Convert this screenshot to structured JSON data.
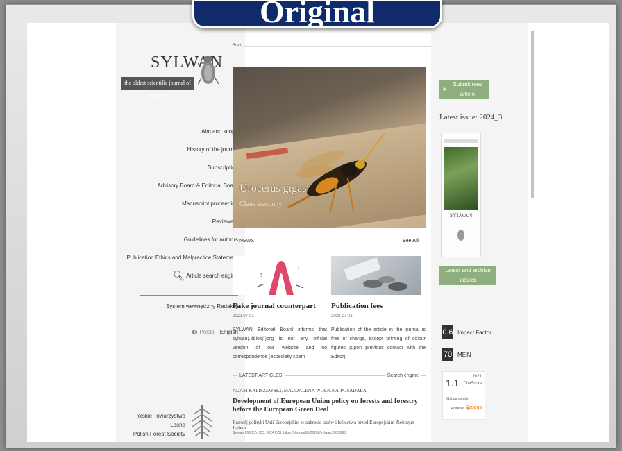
{
  "banner": {
    "label": "Original"
  },
  "journal": {
    "name": "SYLWAN",
    "tagline": "the oldest scientific journal of forestry"
  },
  "sidebar": {
    "menu": [
      {
        "label": "Aim and scope"
      },
      {
        "label": "History of the journal"
      },
      {
        "label": "Subscription"
      },
      {
        "label": "Advisory Board & Editorial Board"
      },
      {
        "label": "Manuscript proceeding"
      },
      {
        "label": "Reviewers"
      },
      {
        "label": "Guidelines for authors"
      },
      {
        "label": "Publication Ethics and Malpractice Statement"
      }
    ],
    "search_label": "Article search engine",
    "system_label": "System wewnętrzny Redakcji",
    "lang_polski": "Polski",
    "lang_sep": "|",
    "lang_english": "English",
    "society": {
      "line1": "Polskie Towarzystwo Leśne",
      "line2": "Polish Forest Society"
    }
  },
  "main": {
    "breadcrumb": "Start",
    "hero": {
      "title": "Urocerus gigas",
      "subtitle": "Claus sraconny"
    },
    "news_header": "NEWS",
    "see_all": "See All",
    "news": [
      {
        "title": "Fake journal counterpart",
        "date": "2022-07-01",
        "text": "SYLWAN Editorial Board informs that sylwan(.)lblos(.)org is not any official version of our website and no correspondence (especially spam"
      },
      {
        "title": "Publication fees",
        "date": "2022-07-01",
        "text": "Publication of the article in the journal is free of charge, except printing of colour figures (upon previous contact with the Editor)."
      }
    ],
    "latest_header": "LATEST ARTICLES",
    "search_engine": "Search engine",
    "article": {
      "authors": "ADAM KALISZEWSKI, MAGDALENA WOLICKA-POSADAŁA",
      "title": "Development of European Union policy on forests and forestry before the European Green Deal",
      "subtitle": "Rozwój polityki Unii Europejskiej w zakresie lasów i leśnictwa przed Europejskim Zielonym Ładem",
      "ref": "Sylwan 168(03): 155, 2024 DOI: https://doi.org/10.26202/sylwan.2023093"
    }
  },
  "right": {
    "submit_label": "Submit new article",
    "latest_issue": "Latest issue: 2024_3",
    "archive_label": "Latest and archive issues",
    "cover_title": "SYLWAN",
    "impact": {
      "value": "0.6",
      "label": "Impact Factor"
    },
    "mein": {
      "value": "70",
      "label": "MEiN"
    },
    "citescore": {
      "value": "1.1",
      "year": "2021",
      "label": "CiteScore",
      "pct": "31st percentile",
      "powered": "Powered by",
      "brand": "Scopus"
    }
  },
  "colors": {
    "accent_green": "#8fae7e",
    "banner_blue": "#0f2b6b"
  }
}
